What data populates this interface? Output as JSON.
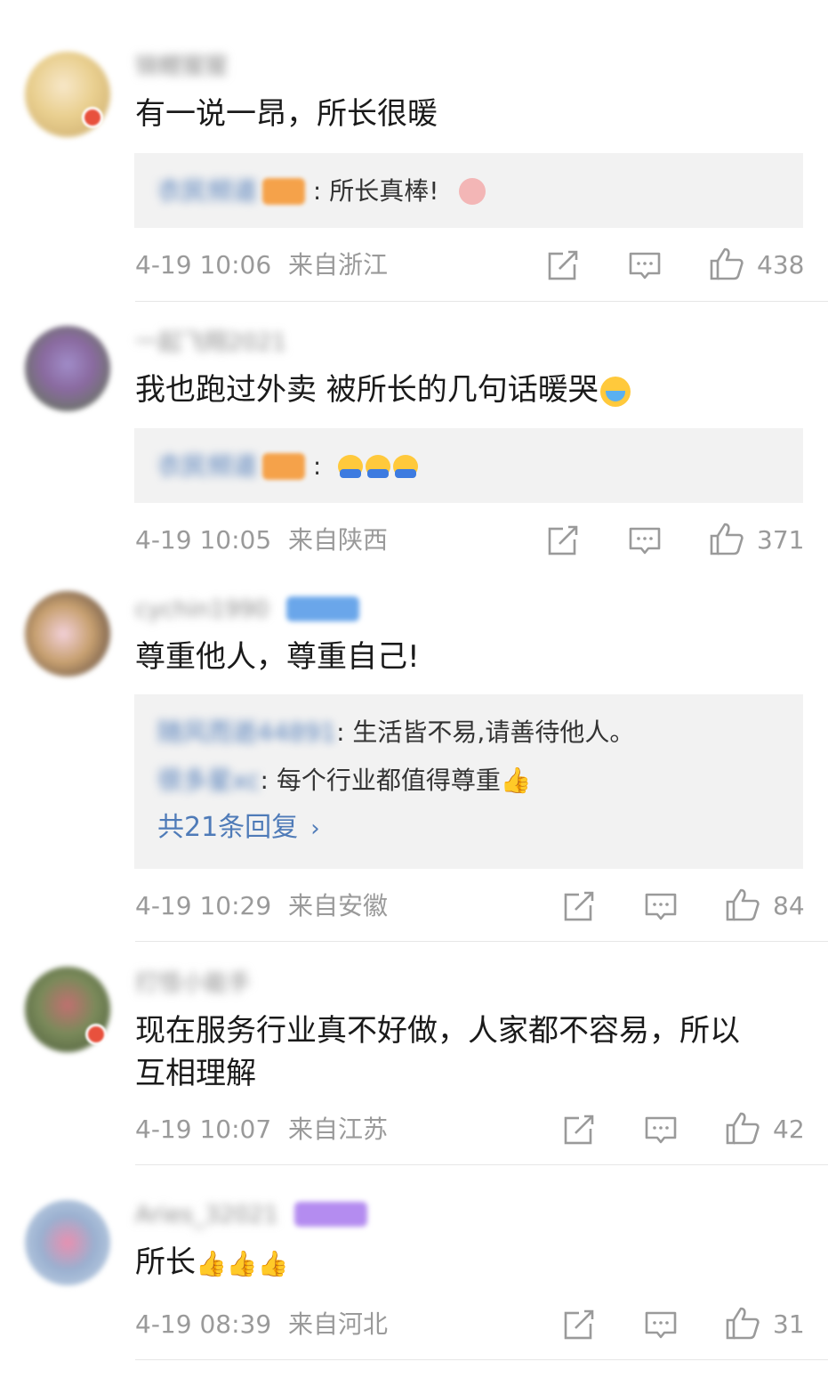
{
  "comments": [
    {
      "username": "锦鲤猩猩",
      "text": "有一说一昂，所长很暖",
      "replies": [
        {
          "author": "衣民频道",
          "text": ": 所长真棒!"
        }
      ],
      "time": "4-19 10:06",
      "location": "来自浙江",
      "likes": "438"
    },
    {
      "username": "一起飞翔2021",
      "text": "我也跑过外卖 被所长的几句话暖哭",
      "replies": [
        {
          "author": "衣民频道",
          "text": ":"
        }
      ],
      "time": "4-19 10:05",
      "location": "来自陕西",
      "likes": "371"
    },
    {
      "username": "cychin1990",
      "text": "尊重他人，尊重自己!",
      "replies": [
        {
          "author": "随风而逝44891",
          "text": ": 生活皆不易,请善待他人。"
        },
        {
          "author": "很多星xc",
          "text": ": 每个行业都值得尊重"
        }
      ],
      "more_replies": "共21条回复",
      "time": "4-19 10:29",
      "location": "来自安徽",
      "likes": "84"
    },
    {
      "username": "打怪小能手",
      "text": "现在服务行业真不好做，人家都不容易，所以\n互相理解",
      "time": "4-19 10:07",
      "location": "来自江苏",
      "likes": "42"
    },
    {
      "username": "Aries_32021",
      "text": "所长",
      "time": "4-19 08:39",
      "location": "来自河北",
      "likes": "31"
    }
  ],
  "icons": {
    "share": "share-icon",
    "comment": "comment-icon",
    "like": "thumb-up-icon"
  },
  "colors": {
    "link": "#4f7bb8",
    "meta": "#9a9a9a",
    "reply_bg": "#f2f2f2"
  }
}
